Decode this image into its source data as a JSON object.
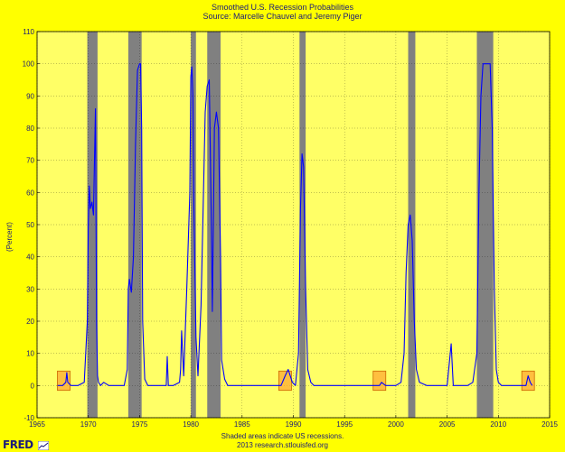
{
  "chart_data": {
    "type": "line",
    "title": "Smoothed U.S. Recession Probabilities",
    "subtitle": "Source: Marcelle Chauvel and Jeremy Piger",
    "ylabel": "(Percent)",
    "xlim": [
      1965,
      2015
    ],
    "ylim": [
      -10,
      110
    ],
    "xticks": [
      1965,
      1970,
      1975,
      1980,
      1985,
      1990,
      1995,
      2000,
      2005,
      2010,
      2015
    ],
    "yticks": [
      -10,
      0,
      10,
      20,
      30,
      40,
      50,
      60,
      70,
      80,
      90,
      100,
      110
    ],
    "grid": true,
    "recessions": [
      [
        1969.9,
        1970.9
      ],
      [
        1973.9,
        1975.2
      ],
      [
        1980.0,
        1980.5
      ],
      [
        1981.6,
        1982.9
      ],
      [
        1990.6,
        1991.2
      ],
      [
        2001.2,
        2001.9
      ],
      [
        2007.9,
        2009.5
      ]
    ],
    "highlight_boxes": [
      1967.6,
      1989.2,
      1998.4,
      2012.9
    ],
    "series": [
      {
        "color": "#0000ff",
        "x": [
          1967.0,
          1967.5,
          1967.8,
          1967.9,
          1968.0,
          1968.3,
          1969.0,
          1969.6,
          1969.9,
          1970.0,
          1970.1,
          1970.2,
          1970.35,
          1970.5,
          1970.6,
          1970.7,
          1970.8,
          1970.9,
          1971.0,
          1971.2,
          1971.5,
          1972.0,
          1972.5,
          1973.0,
          1973.5,
          1973.8,
          1973.9,
          1974.0,
          1974.2,
          1974.4,
          1974.6,
          1974.8,
          1975.0,
          1975.1,
          1975.2,
          1975.3,
          1975.5,
          1975.8,
          1976.5,
          1977.0,
          1977.6,
          1977.7,
          1977.8,
          1978.3,
          1978.9,
          1979.0,
          1979.1,
          1979.3,
          1979.6,
          1979.9,
          1980.0,
          1980.1,
          1980.2,
          1980.3,
          1980.5,
          1980.7,
          1981.0,
          1981.4,
          1981.6,
          1981.8,
          1982.0,
          1982.1,
          1982.3,
          1982.5,
          1982.7,
          1982.9,
          1983.0,
          1983.3,
          1983.6,
          1984.0,
          1985.0,
          1986.0,
          1987.0,
          1988.0,
          1988.8,
          1989.2,
          1989.5,
          1989.9,
          1990.2,
          1990.5,
          1990.7,
          1990.85,
          1991.0,
          1991.2,
          1991.4,
          1991.7,
          1992.0,
          1993.0,
          1995.0,
          1997.0,
          1998.4,
          1998.6,
          1999.0,
          2000.0,
          2000.5,
          2000.8,
          2001.0,
          2001.2,
          2001.4,
          2001.6,
          2001.8,
          2002.0,
          2002.3,
          2003.0,
          2004.0,
          2005.0,
          2005.4,
          2005.6,
          2005.8,
          2006.5,
          2007.0,
          2007.5,
          2007.9,
          2008.1,
          2008.3,
          2008.5,
          2008.7,
          2009.0,
          2009.2,
          2009.4,
          2009.6,
          2009.8,
          2010.0,
          2010.3,
          2011.0,
          2012.0,
          2012.7,
          2012.9,
          2013.1,
          2013.3
        ],
        "y": [
          0,
          0,
          1,
          4,
          1,
          0,
          0,
          1,
          20,
          50,
          62,
          55,
          57,
          53,
          70,
          86,
          20,
          3,
          1,
          0,
          1,
          0,
          0,
          0,
          0,
          5,
          30,
          33,
          29,
          40,
          75,
          98,
          100,
          100,
          80,
          20,
          2,
          0,
          0,
          0,
          0,
          9,
          0,
          0,
          1,
          5,
          17,
          3,
          30,
          60,
          96,
          99,
          90,
          55,
          15,
          3,
          25,
          85,
          93,
          95,
          50,
          23,
          80,
          85,
          80,
          40,
          8,
          2,
          0,
          0,
          0,
          0,
          0,
          0,
          0,
          3,
          5,
          1,
          0,
          10,
          55,
          72,
          68,
          30,
          5,
          1,
          0,
          0,
          0,
          0,
          0,
          1,
          0,
          0,
          1,
          10,
          35,
          50,
          53,
          45,
          20,
          5,
          1,
          0,
          0,
          0,
          13,
          0,
          0,
          0,
          0,
          1,
          10,
          60,
          90,
          100,
          100,
          100,
          100,
          80,
          30,
          5,
          1,
          0,
          0,
          0,
          0,
          3,
          1,
          0
        ]
      }
    ]
  },
  "footer": {
    "note": "Shaded areas indicate US recessions.",
    "credit": "2013 research.stlouisfed.org",
    "logo_text": "FRED"
  }
}
